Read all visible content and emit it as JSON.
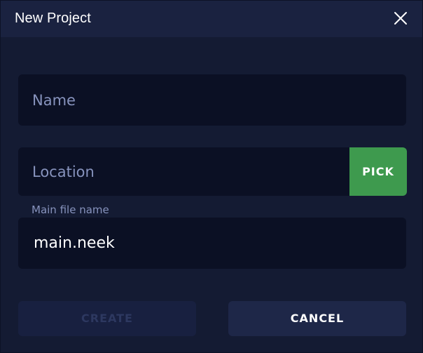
{
  "dialog": {
    "title": "New Project"
  },
  "fields": {
    "name": {
      "placeholder": "Name",
      "value": ""
    },
    "location": {
      "placeholder": "Location",
      "value": ""
    },
    "main_file": {
      "label": "Main file name",
      "value": "main.neek"
    }
  },
  "buttons": {
    "pick": "PICK",
    "create": "CREATE",
    "cancel": "CANCEL"
  },
  "icons": {
    "close": "close-icon"
  },
  "colors": {
    "background": "#141b33",
    "titlebar": "#1a2240",
    "field": "#0b1024",
    "accent_green": "#3e9a4e",
    "placeholder": "#8793bd",
    "disabled_text": "#2d3860"
  }
}
